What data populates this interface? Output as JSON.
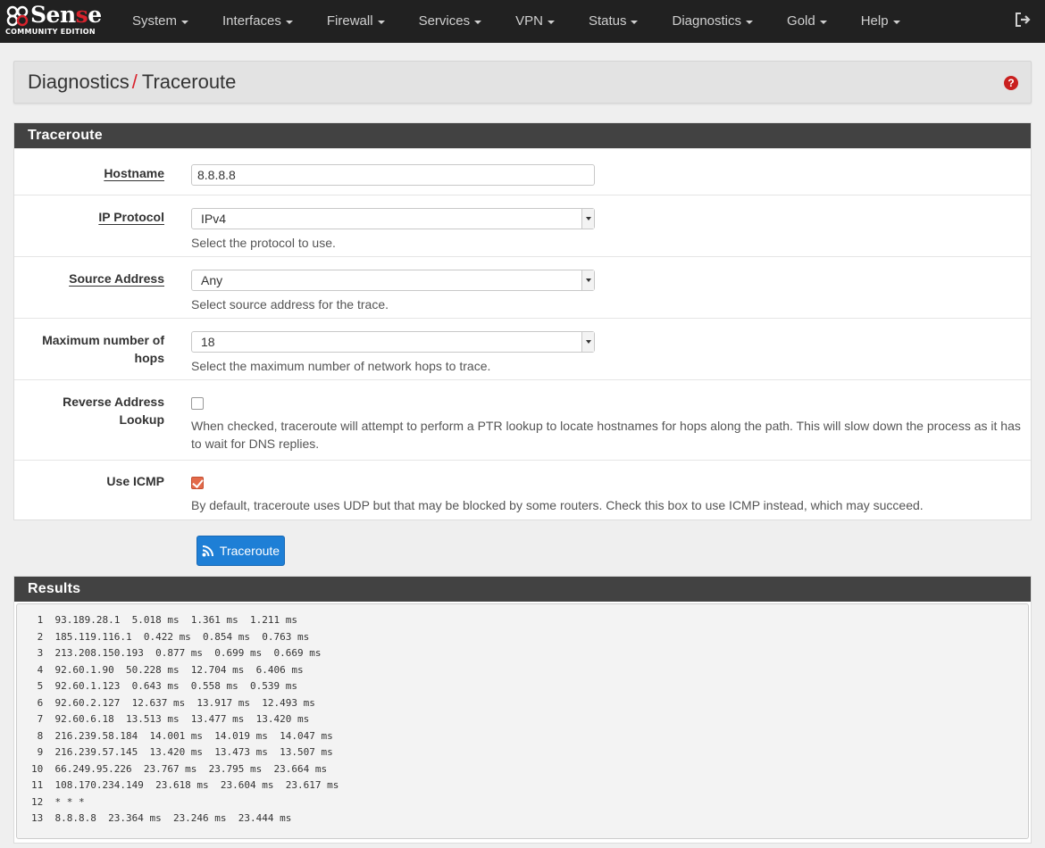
{
  "brand": {
    "name_pre": "pf",
    "name_a": "Sen",
    "name_b": "s",
    "name_c": "e",
    "subtitle": "COMMUNITY EDITION"
  },
  "nav": {
    "items": [
      "System",
      "Interfaces",
      "Firewall",
      "Services",
      "VPN",
      "Status",
      "Diagnostics",
      "Gold",
      "Help"
    ]
  },
  "breadcrumb": {
    "parent": "Diagnostics",
    "separator": "/",
    "current": "Traceroute"
  },
  "form": {
    "heading": "Traceroute",
    "hostname": {
      "label": "Hostname",
      "value": "8.8.8.8"
    },
    "ip_protocol": {
      "label": "IP Protocol",
      "value": "IPv4",
      "help": "Select the protocol to use."
    },
    "source_address": {
      "label": "Source Address",
      "value": "Any",
      "help": "Select source address for the trace."
    },
    "max_hops": {
      "label_line1": "Maximum number of",
      "label_line2": "hops",
      "value": "18",
      "help": "Select the maximum number of network hops to trace."
    },
    "reverse_lookup": {
      "label": "Reverse Address Lookup",
      "checked": false,
      "help_line1": "When checked, traceroute will attempt to perform a PTR lookup to locate hostnames for hops along the path. This will slow down the process as it has",
      "help_line2": "to wait for DNS replies."
    },
    "use_icmp": {
      "label": "Use ICMP",
      "checked": true,
      "help": "By default, traceroute uses UDP but that may be blocked by some routers. Check this box to use ICMP instead, which may succeed."
    },
    "submit_label": "Traceroute"
  },
  "results": {
    "heading": "Results",
    "lines": [
      " 1  93.189.28.1  5.018 ms  1.361 ms  1.211 ms",
      " 2  185.119.116.1  0.422 ms  0.854 ms  0.763 ms",
      " 3  213.208.150.193  0.877 ms  0.699 ms  0.669 ms",
      " 4  92.60.1.90  50.228 ms  12.704 ms  6.406 ms",
      " 5  92.60.1.123  0.643 ms  0.558 ms  0.539 ms",
      " 6  92.60.2.127  12.637 ms  13.917 ms  12.493 ms",
      " 7  92.60.6.18  13.513 ms  13.477 ms  13.420 ms",
      " 8  216.239.58.184  14.001 ms  14.019 ms  14.047 ms",
      " 9  216.239.57.145  13.420 ms  13.473 ms  13.507 ms",
      "10  66.249.95.226  23.767 ms  23.795 ms  23.664 ms",
      "11  108.170.234.149  23.618 ms  23.604 ms  23.617 ms",
      "12  * * *",
      "13  8.8.8.8  23.364 ms  23.246 ms  23.444 ms"
    ]
  }
}
